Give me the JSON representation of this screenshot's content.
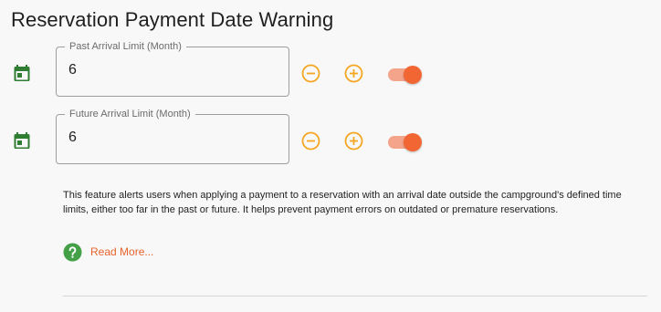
{
  "section": {
    "title": "Reservation Payment Date Warning"
  },
  "fields": [
    {
      "label": "Past Arrival Limit (Month)",
      "value": "6",
      "icon": "calendar-icon",
      "enabled": true
    },
    {
      "label": "Future Arrival Limit (Month)",
      "value": "6",
      "icon": "calendar-icon",
      "enabled": true
    }
  ],
  "description": "This feature alerts users when applying a payment to a reservation with an arrival date outside the campground's defined time limits, either too far in the past or future. It helps prevent payment errors on outdated or premature reservations.",
  "read_more": {
    "label": "Read More...",
    "icon": "help-circle-icon"
  },
  "colors": {
    "accent": "#F26633",
    "accent_track": "#F4A48A",
    "stepper": "#F5A623",
    "calendar_icon": "#2E7D32",
    "help_icon": "#43A047",
    "link": "#E8632D",
    "field_border": "#9E9E9E"
  }
}
